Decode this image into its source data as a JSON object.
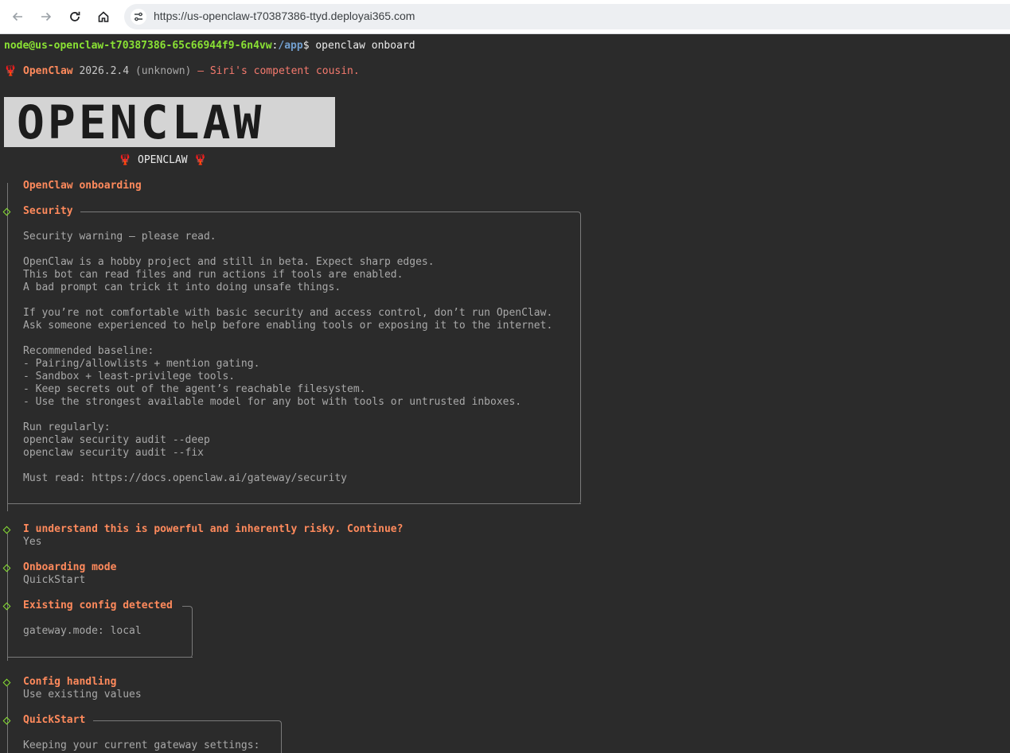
{
  "browser": {
    "url": "https://us-openclaw-t70387386-ttyd.deployai365.com",
    "icons": [
      "back-arrow-icon",
      "forward-arrow-icon",
      "reload-icon",
      "home-icon",
      "site-info-icon"
    ]
  },
  "terminal": {
    "prompt": {
      "user_host": "node@us-openclaw-t70387386-65c66944f9-6n4vw",
      "colon": ":",
      "path": "/app",
      "dollar": "$",
      "command": " openclaw onboard"
    },
    "header": {
      "lobster": "🦞",
      "name": "OpenClaw",
      "version": "2026.2.4",
      "build": "(unknown)",
      "tagline": "— Siri's competent cousin."
    },
    "banner": {
      "art_text": "OPENCLAW",
      "caption": "🦞 OPENCLAW 🦞"
    },
    "onboarding_title": "OpenClaw onboarding",
    "security": {
      "title": "Security",
      "lines": [
        "Security warning — please read.",
        "",
        "OpenClaw is a hobby project and still in beta. Expect sharp edges.",
        "This bot can read files and run actions if tools are enabled.",
        "A bad prompt can trick it into doing unsafe things.",
        "",
        "If you’re not comfortable with basic security and access control, don’t run OpenClaw.",
        "Ask someone experienced to help before enabling tools or exposing it to the internet.",
        "",
        "Recommended baseline:",
        "- Pairing/allowlists + mention gating.",
        "- Sandbox + least-privilege tools.",
        "- Keep secrets out of the agent’s reachable filesystem.",
        "- Use the strongest available model for any bot with tools or untrusted inboxes.",
        "",
        "Run regularly:",
        "openclaw security audit --deep",
        "openclaw security audit --fix",
        "",
        "Must read: https://docs.openclaw.ai/gateway/security"
      ]
    },
    "risk_question": {
      "title": "I understand this is powerful and inherently risky. Continue?",
      "answer": "Yes"
    },
    "onboarding_mode": {
      "title": "Onboarding mode",
      "answer": "QuickStart"
    },
    "existing_config": {
      "title": "Existing config detected",
      "line": "gateway.mode: local"
    },
    "config_handling": {
      "title": "Config handling",
      "answer": "Use existing values"
    },
    "quickstart": {
      "title": "QuickStart",
      "line": "Keeping your current gateway settings:"
    }
  }
}
